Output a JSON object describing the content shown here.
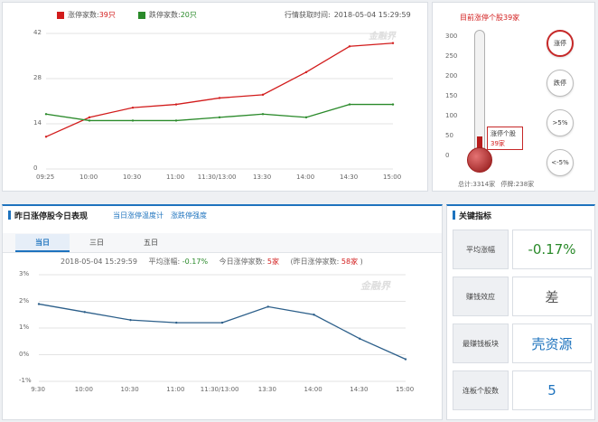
{
  "top_chart": {
    "legend": {
      "limit_up_label": "涨停家数:",
      "limit_up_value": "39只",
      "limit_down_label": "跌停家数:",
      "limit_down_value": "20只",
      "time_label": "行情获取时间:",
      "time_value": "2018-05-04 15:29:59"
    },
    "watermark": "金融界",
    "colors": {
      "up": "#d21c1c",
      "down": "#2a8a2a"
    }
  },
  "thermometer": {
    "title": "目前涨停个股39家",
    "scale": [
      "300",
      "250",
      "200",
      "150",
      "100",
      "50",
      "0"
    ],
    "callout_line1": "涨停个股",
    "callout_line2": "39家",
    "level_value": 39,
    "total_label": "总计:",
    "total_value": "3314家",
    "stop_label": "停牌:",
    "stop_value": "238家",
    "buttons": [
      "涨停",
      "跌停",
      ">5%",
      "<-5%"
    ]
  },
  "bottom": {
    "title": "昨日涨停股今日表现",
    "link1": "当日涨停温度计",
    "link2": "涨跌停强度",
    "tabs": [
      "当日",
      "三日",
      "五日"
    ],
    "info": {
      "time": "2018-05-04 15:29:59",
      "avg_label": "平均涨幅:",
      "avg_value": "-0.17%",
      "today_label": "今日涨停家数:",
      "today_value": "5家",
      "prev_label": "(昨日涨停家数:",
      "prev_value": "58家",
      "prev_close": ")"
    },
    "watermark": "金融界"
  },
  "indicators": {
    "title": "关键指标",
    "rows": [
      {
        "label": "平均涨幅",
        "value": "-0.17%",
        "color": "#2a8a2a"
      },
      {
        "label": "赚钱效应",
        "value": "差",
        "color": "#555555"
      },
      {
        "label": "最赚钱板块",
        "value": "壳资源",
        "color": "#1e73be"
      },
      {
        "label": "连板个股数",
        "value": "5",
        "color": "#1e73be"
      }
    ]
  },
  "chart_data": [
    {
      "type": "line",
      "x": [
        "09:25",
        "10:00",
        "10:30",
        "11:00",
        "11:30/13:00",
        "13:30",
        "14:00",
        "14:30",
        "15:00"
      ],
      "ylim": [
        0,
        42
      ],
      "yticks": [
        0,
        14,
        28,
        42
      ],
      "series": [
        {
          "name": "涨停家数",
          "color": "#d21c1c",
          "values": [
            10,
            16,
            19,
            20,
            22,
            23,
            30,
            38,
            39
          ]
        },
        {
          "name": "跌停家数",
          "color": "#2a8a2a",
          "values": [
            17,
            15,
            15,
            15,
            16,
            17,
            16,
            20,
            20
          ]
        }
      ]
    },
    {
      "type": "line",
      "x": [
        "9:30",
        "10:00",
        "10:30",
        "11:00",
        "11:30/13:00",
        "13:30",
        "14:00",
        "14:30",
        "15:00"
      ],
      "ylim": [
        -1,
        3
      ],
      "yticks": [
        -1,
        0,
        1,
        2,
        3
      ],
      "ytick_labels": [
        "-1%",
        "0%",
        "1%",
        "2%",
        "3%"
      ],
      "series": [
        {
          "color": "#2c5f8a",
          "values": [
            1.9,
            1.6,
            1.3,
            1.2,
            1.2,
            1.8,
            1.5,
            0.6,
            -0.17
          ]
        }
      ]
    }
  ]
}
